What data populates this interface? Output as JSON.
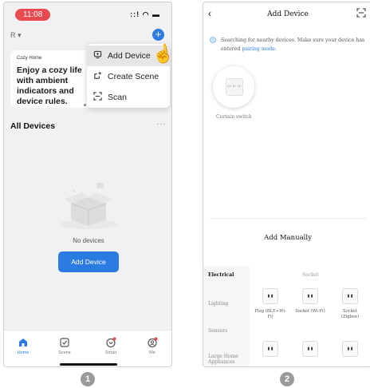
{
  "phone1": {
    "status": {
      "time": "11:08",
      "icons": "::! ◠ ▬"
    },
    "home_selector": "R ▾",
    "add_button": "+",
    "cozy_card": {
      "tag": "Cozy Home",
      "text": "Enjoy a cozy life with ambient indicators and device rules."
    },
    "menu": [
      {
        "label": "Add Device",
        "icon": "add-device-icon"
      },
      {
        "label": "Create Scene",
        "icon": "create-scene-icon"
      },
      {
        "label": "Scan",
        "icon": "scan-icon"
      }
    ],
    "all_devices": "All Devices",
    "more": "···",
    "no_devices": "No devices",
    "add_device_button": "Add Device",
    "tabs": [
      {
        "label": "Home",
        "active": true
      },
      {
        "label": "Scene",
        "active": false
      },
      {
        "label": "Smart",
        "active": false
      },
      {
        "label": "Me",
        "active": false
      }
    ]
  },
  "phone2": {
    "back": "‹",
    "title": "Add Device",
    "searching_text": "Searching for nearby devices. Make sure your device has entered",
    "pairing_link": "pairing mode",
    "searching_end": ".",
    "found_device_label": "Curtain switch",
    "found_device_screen": "II II II",
    "add_manually": "Add Manually",
    "categories": [
      "Electrical",
      "Lighting",
      "Sensors",
      "Large Home Appliances"
    ],
    "section_label": "Socket",
    "devices": [
      {
        "name": "Plug (BLE+Wi-Fi)"
      },
      {
        "name": "Socket (Wi-Fi)"
      },
      {
        "name": "Socket (Zigbee)"
      },
      {
        "name": ""
      },
      {
        "name": ""
      },
      {
        "name": ""
      }
    ]
  },
  "steps": [
    "1",
    "2"
  ],
  "colors": {
    "accent": "#2b7be3",
    "time_pill": "#e84a50",
    "badge": "#e84a50"
  }
}
